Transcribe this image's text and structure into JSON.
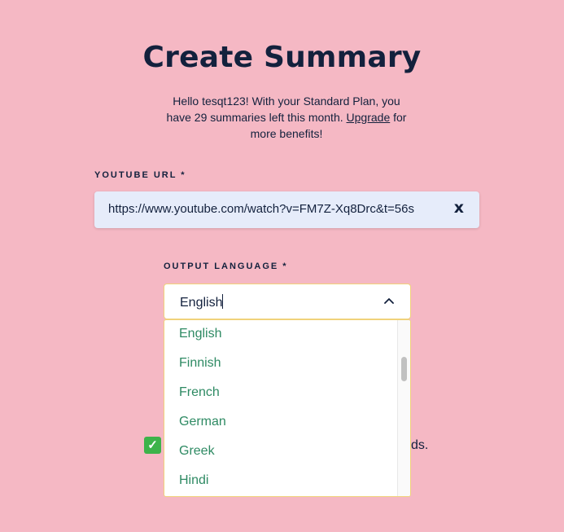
{
  "page": {
    "title": "Create Summary"
  },
  "intro": {
    "text_before": "Hello tesqt123! With your Standard Plan, you have 29 summaries left this month.",
    "upgrade_link": "Upgrade",
    "text_after": "for more benefits!"
  },
  "youtube_url": {
    "label": "YOUTUBE URL *",
    "value": "https://www.youtube.com/watch?v=FM7Z-Xq8Drc&t=56s",
    "clear_label": "x"
  },
  "output_language": {
    "label": "OUTPUT LANGUAGE *",
    "value": "English",
    "options": [
      "English",
      "Finnish",
      "French",
      "German",
      "Greek",
      "Hindi"
    ]
  },
  "background_partial": {
    "checkmark": "✓",
    "trailing_text": "ds."
  },
  "colors": {
    "background": "#f5b8c4",
    "heading": "#13213d",
    "url_field_bg": "#e6ecfa",
    "option_text": "#2e8a63",
    "dropdown_border": "#f0d27a",
    "check_green": "#3db34a"
  },
  "icons": {
    "select_toggle": "chevron-up-icon",
    "status": "check-icon"
  }
}
